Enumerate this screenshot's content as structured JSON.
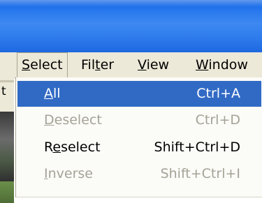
{
  "menubar": {
    "items": [
      {
        "pre": "",
        "u": "S",
        "post": "elect"
      },
      {
        "pre": "Fil",
        "u": "t",
        "post": "er"
      },
      {
        "pre": "",
        "u": "V",
        "post": "iew"
      },
      {
        "pre": "",
        "u": "W",
        "post": "indow"
      }
    ]
  },
  "left_edge_text": "t",
  "select_menu": {
    "items": [
      {
        "pre": "",
        "u": "A",
        "post": "ll",
        "shortcut": "Ctrl+A",
        "state": "highlighted"
      },
      {
        "pre": "",
        "u": "D",
        "post": "eselect",
        "shortcut": "Ctrl+D",
        "state": "disabled"
      },
      {
        "pre": "R",
        "u": "e",
        "post": "select",
        "shortcut": "Shift+Ctrl+D",
        "state": "enabled"
      },
      {
        "pre": "",
        "u": "I",
        "post": "nverse",
        "shortcut": "Shift+Ctrl+I",
        "state": "disabled"
      }
    ]
  },
  "colors": {
    "titlebar": "#2a79ee",
    "menubar_bg": "#ece9d8",
    "highlight": "#316ac5",
    "disabled_text": "#a5a396"
  }
}
